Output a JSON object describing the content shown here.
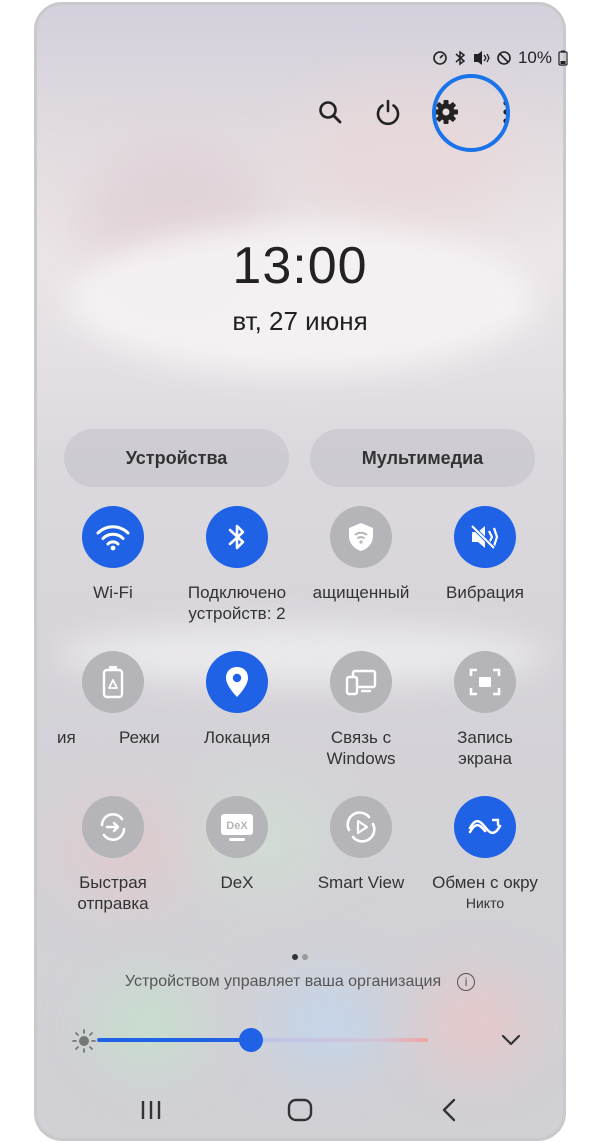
{
  "status_bar": {
    "battery_percent": "10%"
  },
  "top_actions": [
    {
      "name": "search-icon"
    },
    {
      "name": "power-icon"
    },
    {
      "name": "settings-icon"
    },
    {
      "name": "more-options-icon"
    }
  ],
  "clock": {
    "time": "13:00",
    "date": "вт, 27 июня"
  },
  "tabs": {
    "devices": "Устройства",
    "media": "Мультимедиа"
  },
  "tiles": {
    "wifi": {
      "label": "Wi-Fi",
      "state": "on"
    },
    "bluetooth": {
      "label": "Подключено устройств: 2",
      "line1": "Подключено",
      "line2": "устройств: 2",
      "state": "on"
    },
    "secure": {
      "label": "ащищенный",
      "state": "off"
    },
    "vibration": {
      "label": "Вибрация",
      "state": "on"
    },
    "power_saving": {
      "label_left": "ия",
      "label_right": "Режи",
      "state": "off"
    },
    "location": {
      "label": "Локация",
      "state": "on"
    },
    "link_windows": {
      "line1": "Связь с",
      "line2": "Windows",
      "state": "off"
    },
    "screen_record": {
      "line1": "Запись",
      "line2": "экрана",
      "state": "off"
    },
    "quick_share": {
      "line1": "Быстрая",
      "line2": "отправка",
      "state": "off"
    },
    "dex": {
      "label": "DeX",
      "icon_text": "DeX",
      "state": "off"
    },
    "smart_view": {
      "label": "Smart View",
      "state": "off"
    },
    "nearby_share": {
      "label": "Обмен с окру",
      "sub": "Никто",
      "state": "on"
    }
  },
  "page_indicator": {
    "pages": 2,
    "current": 1
  },
  "org_notice": "Устройством управляет ваша организация",
  "brightness": {
    "level": 0.46
  },
  "colors": {
    "accent": "#1f62e6",
    "ring": "#1a73e8",
    "tile_off": "#b5b4b8"
  }
}
